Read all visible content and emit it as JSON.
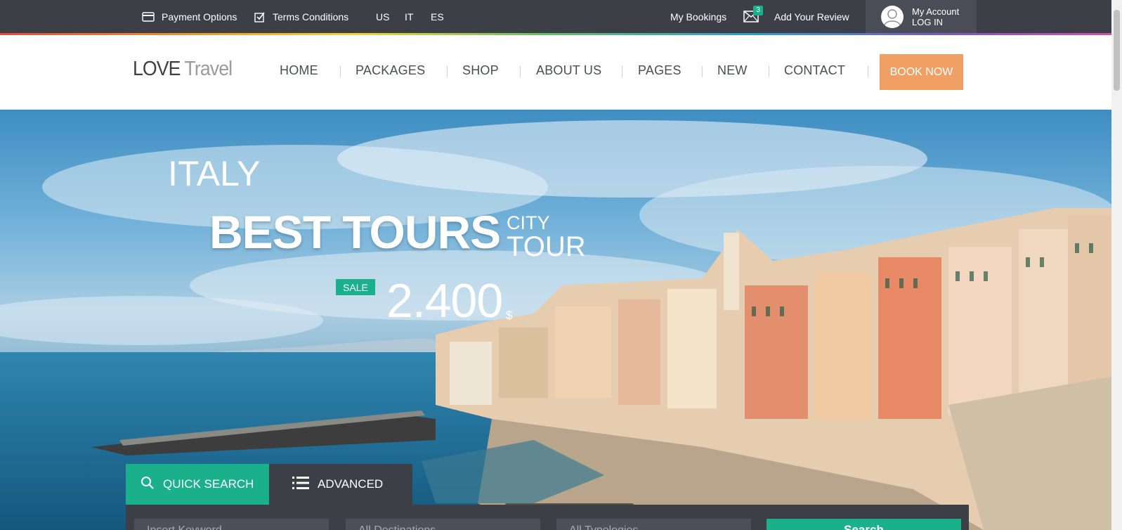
{
  "topbar": {
    "payment_label": "Payment Options",
    "terms_label": "Terms Conditions",
    "languages": [
      "US",
      "IT",
      "ES"
    ],
    "bookings_label": "My Bookings",
    "mail_count": "3",
    "review_label": "Add Your Review",
    "account_label": "My Account",
    "login_label": "LOG IN"
  },
  "header": {
    "logo_part1": "LOVE",
    "logo_part2": "Travel",
    "nav": [
      "HOME",
      "PACKAGES",
      "SHOP",
      "ABOUT US",
      "PAGES",
      "NEW",
      "CONTACT"
    ],
    "book_now": "BOOK NOW"
  },
  "hero": {
    "country": "ITALY",
    "headline": "BEST TOURS",
    "sub1": "CITY",
    "sub2": "TOUR",
    "sale_badge": "SALE",
    "price": "2.400",
    "price_unit": "$"
  },
  "search": {
    "tab_quick": "QUICK SEARCH",
    "tab_advanced": "ADVANCED",
    "field1_placeholder": "Insert Keyword",
    "field2_placeholder": "All Destinations",
    "field3_placeholder": "All Typologies",
    "button": "Search"
  },
  "colors": {
    "dark": "#3c3f46",
    "accent": "#1bb08c",
    "book_now": "#f0a064"
  }
}
